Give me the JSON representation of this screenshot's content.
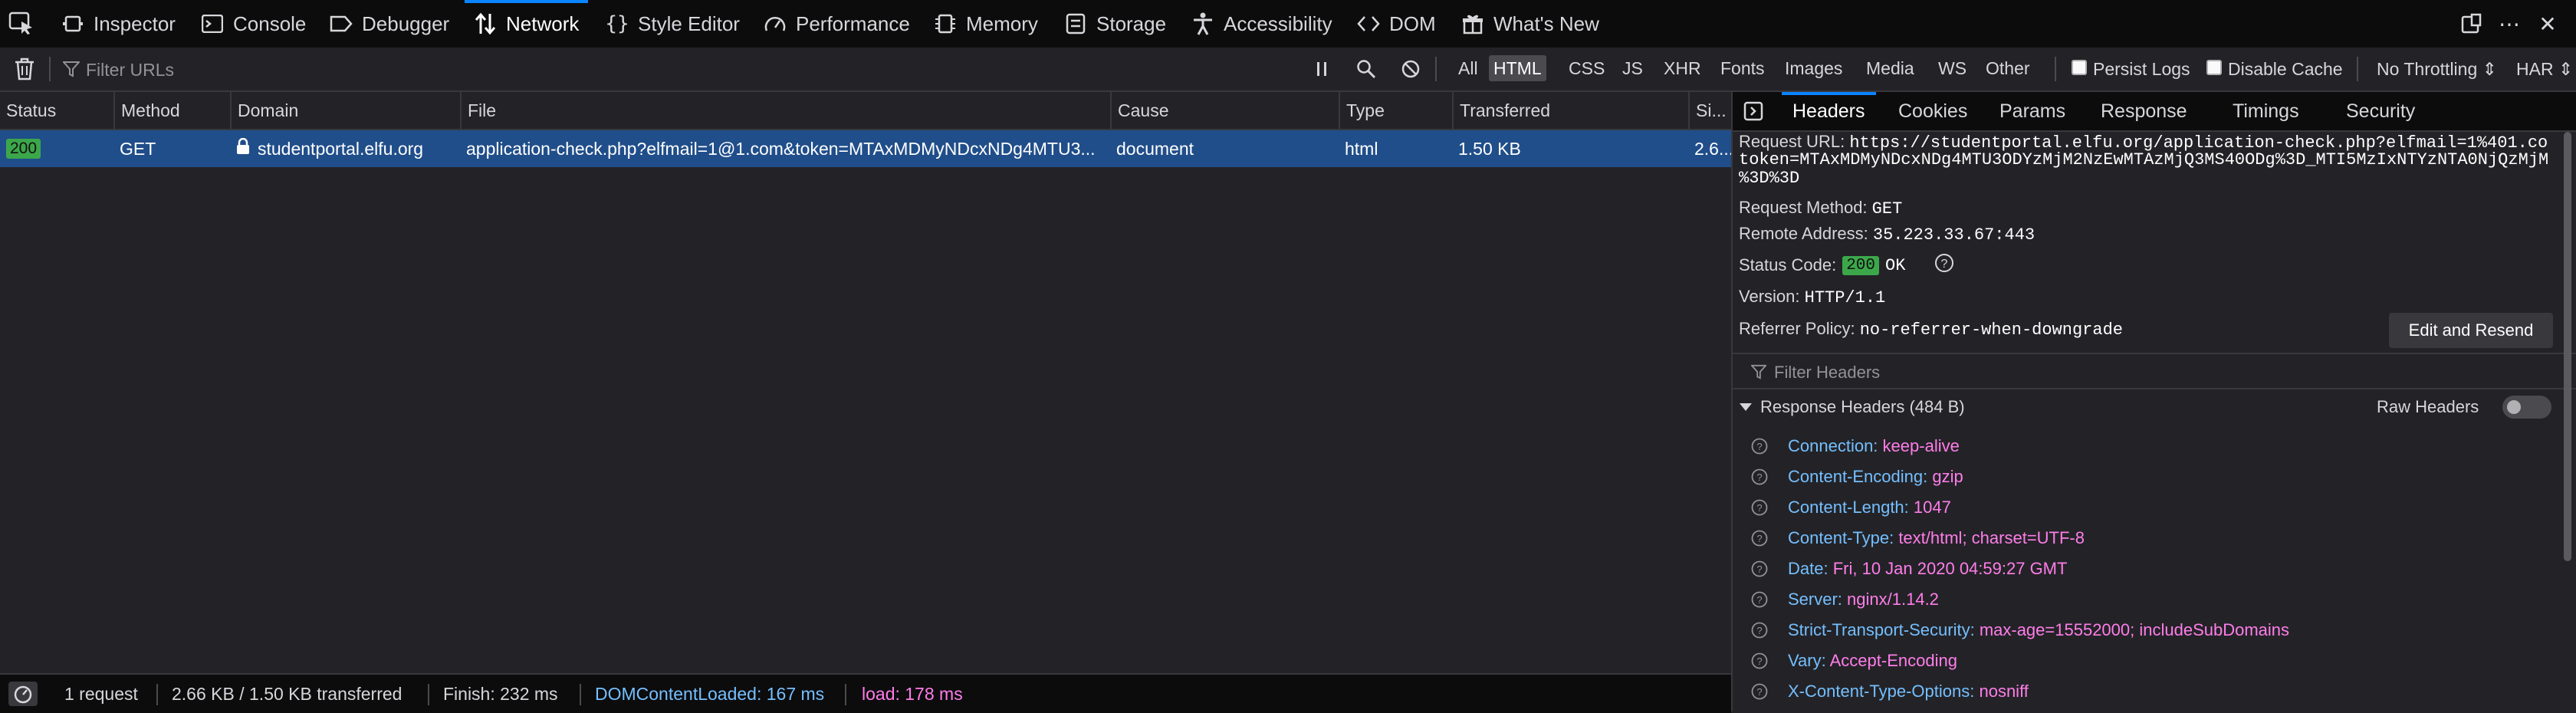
{
  "toolbar": {
    "tools": [
      {
        "label": "Inspector",
        "icon": "inspector-icon"
      },
      {
        "label": "Console",
        "icon": "console-icon"
      },
      {
        "label": "Debugger",
        "icon": "debugger-icon"
      },
      {
        "label": "Network",
        "icon": "network-icon",
        "active": true
      },
      {
        "label": "Style Editor",
        "icon": "braces-icon"
      },
      {
        "label": "Performance",
        "icon": "gauge-icon"
      },
      {
        "label": "Memory",
        "icon": "memory-icon"
      },
      {
        "label": "Storage",
        "icon": "storage-icon"
      },
      {
        "label": "Accessibility",
        "icon": "accessibility-icon"
      },
      {
        "label": "DOM",
        "icon": "dom-icon"
      },
      {
        "label": "What's New",
        "icon": "gift-icon"
      }
    ],
    "right_icons": [
      "dock-icon",
      "more-icon",
      "close-icon"
    ]
  },
  "filterbar": {
    "placeholder": "Filter URLs",
    "types": [
      "All",
      "HTML",
      "CSS",
      "JS",
      "XHR",
      "Fonts",
      "Images",
      "Media",
      "WS",
      "Other"
    ],
    "selected_type": "HTML",
    "persist_logs": "Persist Logs",
    "disable_cache": "Disable Cache",
    "throttling": "No Throttling ⇕",
    "har": "HAR ⇕"
  },
  "table": {
    "columns": [
      "Status",
      "Method",
      "Domain",
      "File",
      "Cause",
      "Type",
      "Transferred",
      "Si..."
    ],
    "rows": [
      {
        "status": "200",
        "method": "GET",
        "domain": "studentportal.elfu.org",
        "file": "application-check.php?elfmail=1@1.com&token=MTAxMDMyNDcxNDg4MTU3...",
        "cause": "document",
        "type": "html",
        "transferred": "1.50 KB",
        "size": "2.6..."
      }
    ]
  },
  "statusbar": {
    "requests": "1 request",
    "transferred": "2.66 KB / 1.50 KB transferred",
    "finish": "Finish: 232 ms",
    "domcontentloaded": "DOMContentLoaded: 167 ms",
    "load": "load: 178 ms"
  },
  "sidepanel": {
    "tabs": [
      "Headers",
      "Cookies",
      "Params",
      "Response",
      "Timings",
      "Security"
    ],
    "active_tab": "Headers",
    "request_url_label": "Request URL:",
    "request_url_line1": "https://studentportal.elfu.org/application-check.php?elfmail=1%401.co",
    "request_url_line2": "token=MTAxMDMyNDcxNDg4MTU3ODYzMjM2NzEwMTAzMjQ3MS40ODg%3D_MTI5MzIxNTYzNTA0NjQzMjM",
    "request_url_line3": "%3D%3D",
    "request_method_label": "Request Method:",
    "request_method": "GET",
    "remote_address_label": "Remote Address:",
    "remote_address": "35.223.33.67:443",
    "status_code_label": "Status Code:",
    "status_code": "200",
    "status_text": "OK",
    "version_label": "Version:",
    "version": "HTTP/1.1",
    "referrer_policy_label": "Referrer Policy:",
    "referrer_policy": "no-referrer-when-downgrade",
    "edit_resend": "Edit and Resend",
    "filter_headers_placeholder": "Filter Headers",
    "response_headers_title": "Response Headers (484 B)",
    "raw_headers": "Raw Headers",
    "headers": [
      {
        "name": "Connection:",
        "value": "keep-alive"
      },
      {
        "name": "Content-Encoding:",
        "value": "gzip"
      },
      {
        "name": "Content-Length:",
        "value": "1047"
      },
      {
        "name": "Content-Type:",
        "value": "text/html; charset=UTF-8"
      },
      {
        "name": "Date:",
        "value": "Fri, 10 Jan 2020 04:59:27 GMT"
      },
      {
        "name": "Server:",
        "value": "nginx/1.14.2"
      },
      {
        "name": "Strict-Transport-Security:",
        "value": "max-age=15552000; includeSubDomains"
      },
      {
        "name": "Vary:",
        "value": "Accept-Encoding"
      },
      {
        "name": "X-Content-Type-Options:",
        "value": "nosniff"
      }
    ]
  },
  "colors": {
    "accent": "#0a84ff",
    "selected_row": "#204e8a",
    "status_ok": "#3ca74a",
    "header_name": "#75bfff",
    "header_value": "#ff7de9"
  }
}
